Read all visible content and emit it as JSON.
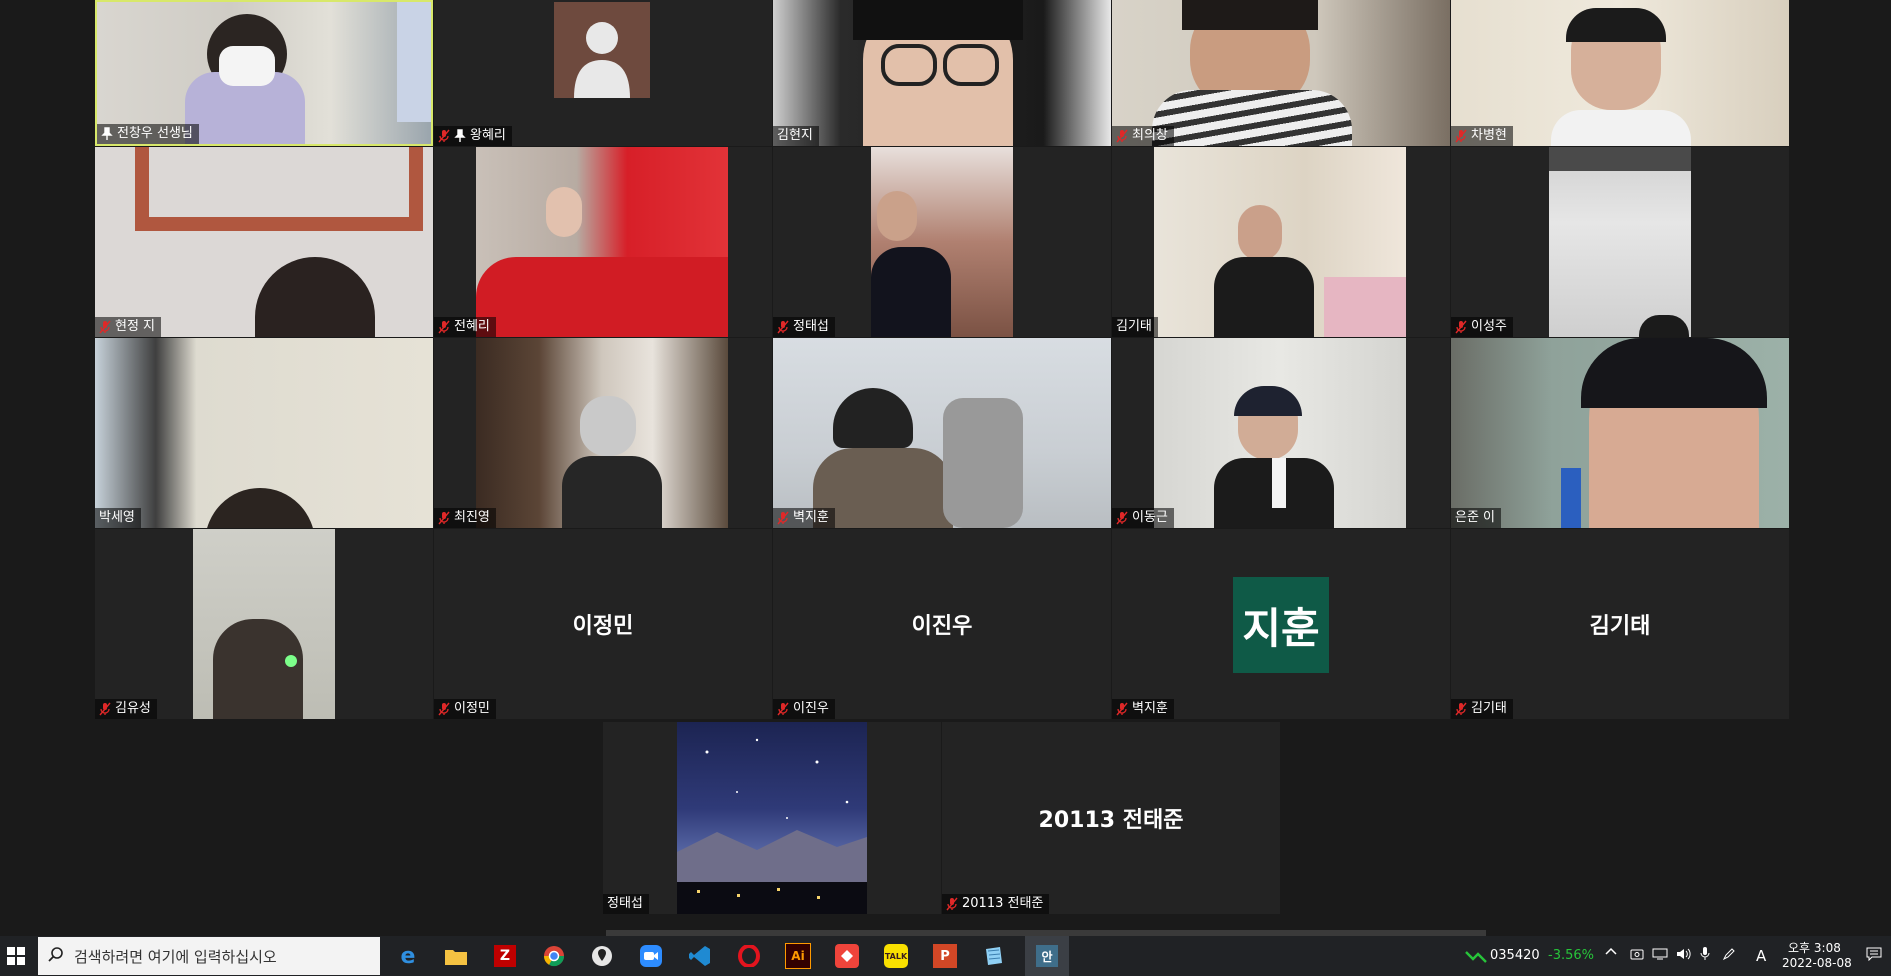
{
  "participants": {
    "p1": "전창우 선생님",
    "p2": "왕혜리",
    "p3": "김현지",
    "p4": "최의창",
    "p5": "차병현",
    "p6": "현정 지",
    "p7": "전혜리",
    "p8": "정태섭",
    "p9": "김기태",
    "p10": "이성주",
    "p11": "박세영",
    "p12": "최진영",
    "p13": "벽지훈",
    "p14": "이동근",
    "p15": "은준 이",
    "p16": "김유성",
    "p17": "이정민",
    "p18": "이진우",
    "p19": "벽지훈",
    "p20": "김기태",
    "p21": "정태섭",
    "p22": "20113 전태준"
  },
  "center_names": {
    "p17": "이정민",
    "p18": "이진우",
    "p19_initials": "지훈",
    "p20": "김기태",
    "p22": "20113 전태준"
  },
  "taskbar": {
    "search_placeholder": "검색하려면 여기에 입력하십시오",
    "stock_code": "035420",
    "stock_change": "-3.56%",
    "ime": "A",
    "time": "오후 3:08",
    "date": "2022-08-08",
    "app_labels": {
      "illustrator": "Ai",
      "kakaotalk": "TALK",
      "powerpoint": "P",
      "active_app": "안"
    }
  },
  "colors": {
    "background": "#1a1a1a",
    "tile": "#232323",
    "active_border": "#d8e86a",
    "initials_bg": "#0f5a47",
    "mute_red": "#e02828",
    "stock_green": "#27c43a"
  }
}
